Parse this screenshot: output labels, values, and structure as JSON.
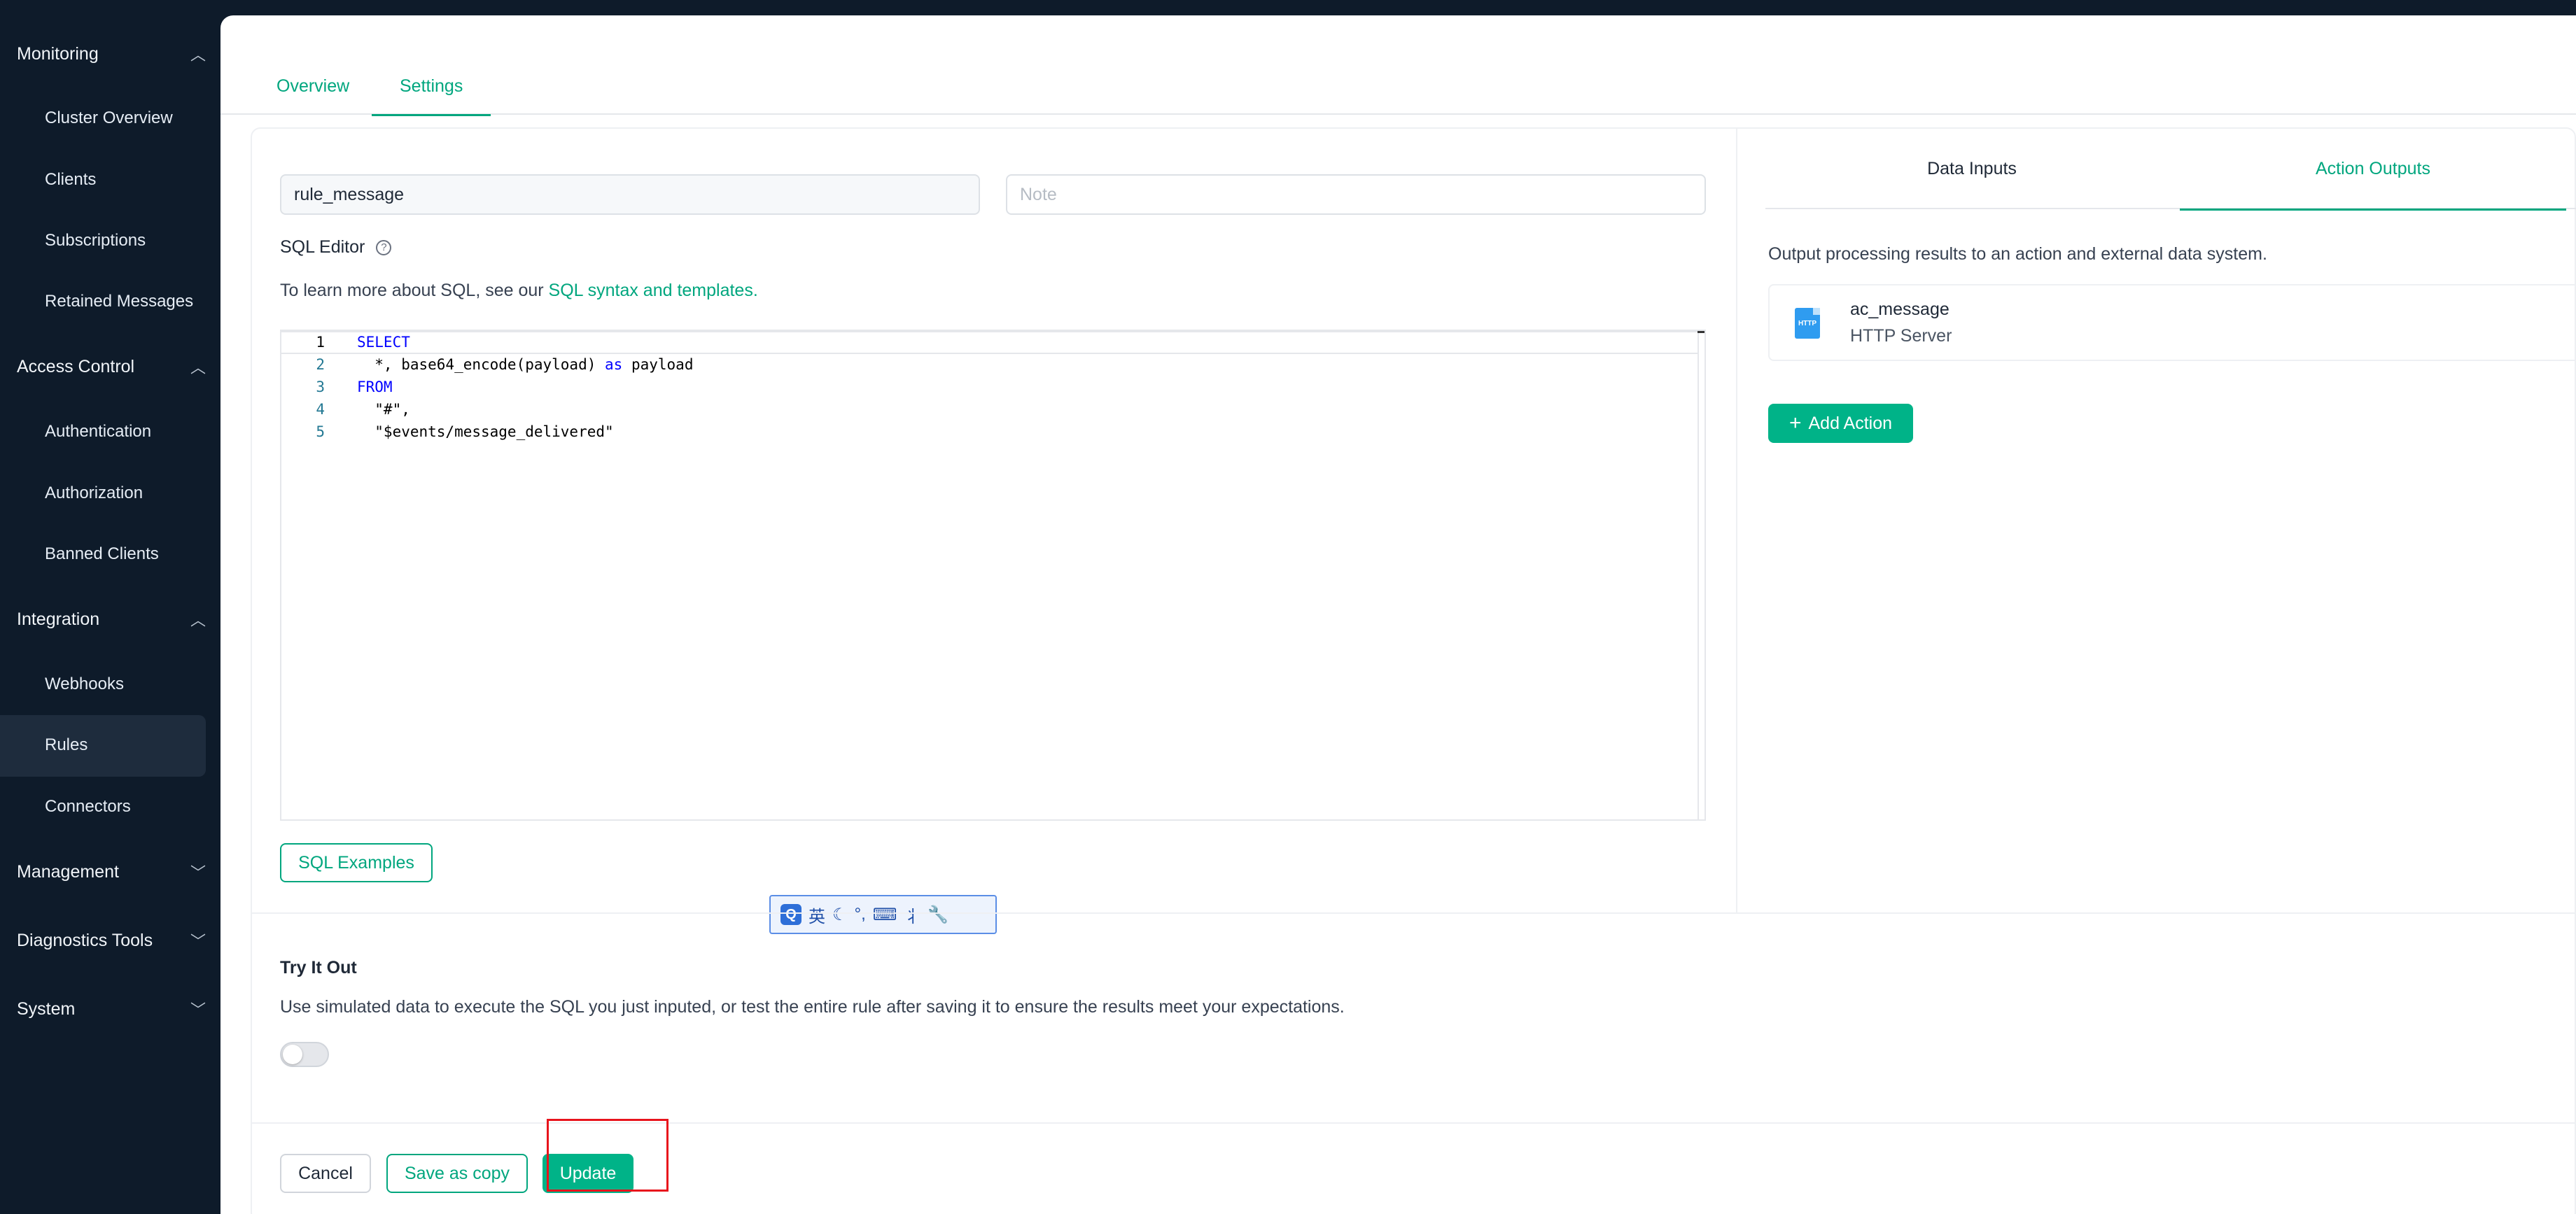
{
  "sidebar": {
    "groups": [
      {
        "label": "Monitoring",
        "expanded": true,
        "items": [
          "Cluster Overview",
          "Clients",
          "Subscriptions",
          "Retained Messages"
        ]
      },
      {
        "label": "Access Control",
        "expanded": true,
        "items": [
          "Authentication",
          "Authorization",
          "Banned Clients"
        ]
      },
      {
        "label": "Integration",
        "expanded": true,
        "items": [
          "Webhooks",
          "Rules",
          "Connectors"
        ]
      },
      {
        "label": "Management",
        "expanded": false,
        "items": []
      },
      {
        "label": "Diagnostics Tools",
        "expanded": false,
        "items": []
      },
      {
        "label": "System",
        "expanded": false,
        "items": []
      }
    ],
    "active_item": "Rules"
  },
  "tabs": {
    "overview": "Overview",
    "settings": "Settings"
  },
  "rule": {
    "name_value": "rule_message",
    "note_placeholder": "Note"
  },
  "sql_editor": {
    "label": "SQL Editor",
    "hint_prefix": "To learn more about SQL, see our ",
    "hint_link": "SQL syntax and templates.",
    "lines": [
      {
        "no": "1",
        "kw": "SELECT",
        "text": ""
      },
      {
        "no": "2",
        "kw": "",
        "text": "  *, base64_encode(payload) ",
        "kw2": "as",
        "text2": " payload"
      },
      {
        "no": "3",
        "kw": "FROM",
        "text": ""
      },
      {
        "no": "4",
        "kw": "",
        "text": "  \"#\","
      },
      {
        "no": "5",
        "kw": "",
        "text": "  \"$events/message_delivered\""
      }
    ],
    "examples_button": "SQL Examples"
  },
  "ime_toolbar": {
    "logo": "Q",
    "lang": "英"
  },
  "right_panel": {
    "tab_inputs": "Data Inputs",
    "tab_outputs": "Action Outputs",
    "description": "Output processing results to an action and external data system.",
    "output": {
      "name": "ac_message",
      "type": "HTTP Server",
      "icon_text": "HTTP"
    },
    "add_action": "Add Action"
  },
  "try_it_out": {
    "title": "Try It Out",
    "description": "Use simulated data to execute the SQL you just inputed, or test the entire rule after saving it to ensure the results meet your expectations.",
    "enabled": false
  },
  "footer": {
    "cancel": "Cancel",
    "save_copy": "Save as copy",
    "update": "Update"
  },
  "colors": {
    "accent": "#00a67e",
    "sidebar_bg": "#0e1b2a",
    "highlight_box": "#e8141c"
  }
}
